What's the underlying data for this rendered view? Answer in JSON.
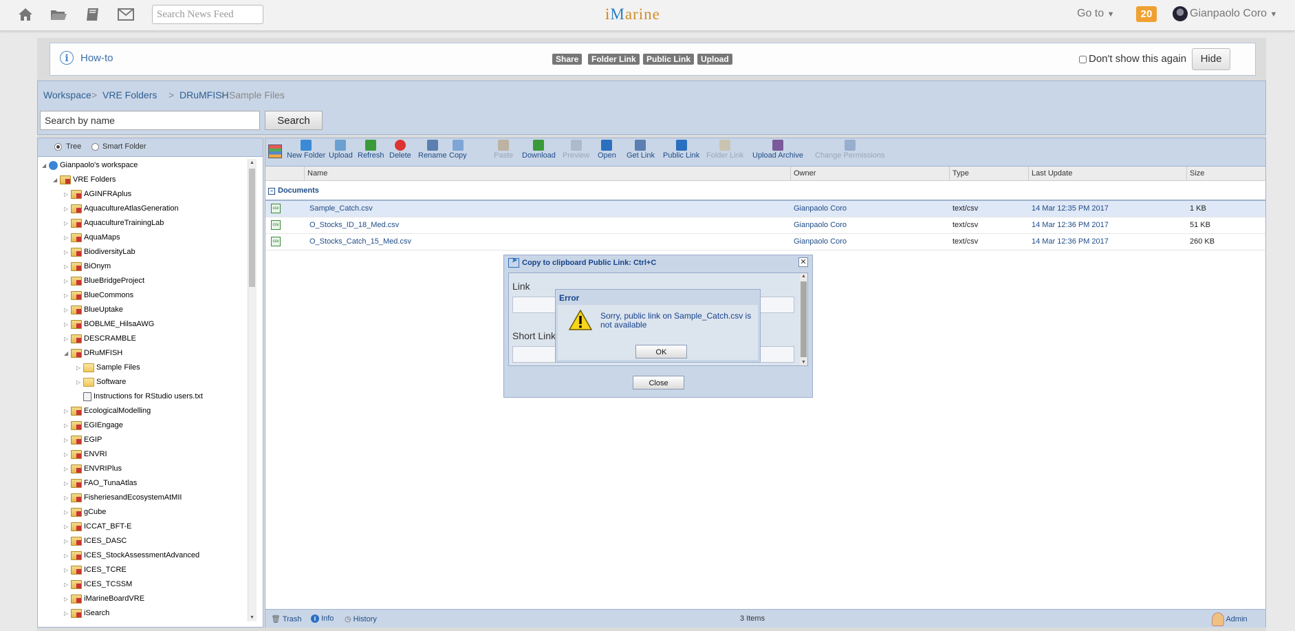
{
  "topnav": {
    "search_placeholder": "Search News Feed",
    "logo_a": "i",
    "logo_b": "M",
    "logo_c": "arine",
    "goto_label": "Go to",
    "notification_count": "20",
    "user_name": "Gianpaolo Coro",
    "icons": [
      "home-icon",
      "folder-icon",
      "book-icon",
      "mail-icon"
    ]
  },
  "howto": {
    "label": "How-to",
    "buttons": [
      "Share",
      "Folder Link",
      "Public Link",
      "Upload"
    ],
    "dont_show": "Don't show this again",
    "hide": "Hide"
  },
  "breadcrumb": {
    "items": [
      "Workspace",
      "VRE Folders",
      "DRuMFISH",
      "Sample Files"
    ],
    "separator": ">"
  },
  "search": {
    "placeholder": "Search by name",
    "button": "Search"
  },
  "tree_options": {
    "tree": "Tree",
    "smart_folder": "Smart Folder"
  },
  "tree": [
    {
      "label": "Gianpaolo's workspace",
      "icon": "user-icon",
      "level": 0,
      "state": "open"
    },
    {
      "label": "VRE Folders",
      "icon": "vre-folder-icon",
      "level": 1,
      "state": "open"
    },
    {
      "label": "AGINFRAplus",
      "icon": "vre-folder-icon",
      "level": 2,
      "state": "closed"
    },
    {
      "label": "AquacultureAtlasGeneration",
      "icon": "vre-folder-icon",
      "level": 2,
      "state": "closed"
    },
    {
      "label": "AquacultureTrainingLab",
      "icon": "vre-folder-icon",
      "level": 2,
      "state": "closed"
    },
    {
      "label": "AquaMaps",
      "icon": "vre-folder-icon",
      "level": 2,
      "state": "closed"
    },
    {
      "label": "BiodiversityLab",
      "icon": "vre-folder-icon",
      "level": 2,
      "state": "closed"
    },
    {
      "label": "BiOnym",
      "icon": "vre-folder-icon",
      "level": 2,
      "state": "closed"
    },
    {
      "label": "BlueBridgeProject",
      "icon": "vre-folder-icon",
      "level": 2,
      "state": "closed"
    },
    {
      "label": "BlueCommons",
      "icon": "vre-folder-icon",
      "level": 2,
      "state": "closed"
    },
    {
      "label": "BlueUptake",
      "icon": "vre-folder-icon",
      "level": 2,
      "state": "closed"
    },
    {
      "label": "BOBLME_HilsaAWG",
      "icon": "vre-folder-icon",
      "level": 2,
      "state": "closed"
    },
    {
      "label": "DESCRAMBLE",
      "icon": "vre-folder-icon",
      "level": 2,
      "state": "closed"
    },
    {
      "label": "DRuMFISH",
      "icon": "vre-folder-icon",
      "level": 2,
      "state": "open"
    },
    {
      "label": "Sample Files",
      "icon": "folder-icon",
      "level": 3,
      "state": "closed"
    },
    {
      "label": "Software",
      "icon": "folder-icon",
      "level": 3,
      "state": "closed"
    },
    {
      "label": "Instructions for RStudio users.txt",
      "icon": "text-file-icon",
      "level": 3,
      "state": "leaf"
    },
    {
      "label": "EcologicalModelling",
      "icon": "vre-folder-icon",
      "level": 2,
      "state": "closed"
    },
    {
      "label": "EGIEngage",
      "icon": "vre-folder-icon",
      "level": 2,
      "state": "closed"
    },
    {
      "label": "EGIP",
      "icon": "vre-folder-icon",
      "level": 2,
      "state": "closed"
    },
    {
      "label": "ENVRI",
      "icon": "vre-folder-icon",
      "level": 2,
      "state": "closed"
    },
    {
      "label": "ENVRIPlus",
      "icon": "vre-folder-icon",
      "level": 2,
      "state": "closed"
    },
    {
      "label": "FAO_TunaAtlas",
      "icon": "vre-folder-icon",
      "level": 2,
      "state": "closed"
    },
    {
      "label": "FisheriesandEcosystemAtMII",
      "icon": "vre-folder-icon",
      "level": 2,
      "state": "closed"
    },
    {
      "label": "gCube",
      "icon": "vre-folder-icon",
      "level": 2,
      "state": "closed"
    },
    {
      "label": "ICCAT_BFT-E",
      "icon": "vre-folder-icon",
      "level": 2,
      "state": "closed"
    },
    {
      "label": "ICES_DASC",
      "icon": "vre-folder-icon",
      "level": 2,
      "state": "closed"
    },
    {
      "label": "ICES_StockAssessmentAdvanced",
      "icon": "vre-folder-icon",
      "level": 2,
      "state": "closed"
    },
    {
      "label": "ICES_TCRE",
      "icon": "vre-folder-icon",
      "level": 2,
      "state": "closed"
    },
    {
      "label": "ICES_TCSSM",
      "icon": "vre-folder-icon",
      "level": 2,
      "state": "closed"
    },
    {
      "label": "iMarineBoardVRE",
      "icon": "vre-folder-icon",
      "level": 2,
      "state": "closed"
    },
    {
      "label": "iSearch",
      "icon": "vre-folder-icon",
      "level": 2,
      "state": "closed"
    }
  ],
  "toolbar": [
    {
      "label": "New Folder",
      "icon": "new-folder-icon",
      "enabled": true
    },
    {
      "label": "Upload",
      "icon": "upload-icon",
      "enabled": true
    },
    {
      "label": "Refresh",
      "icon": "refresh-icon",
      "enabled": true
    },
    {
      "label": "Delete",
      "icon": "delete-icon",
      "enabled": true
    },
    {
      "label": "Rename",
      "icon": "rename-icon",
      "enabled": true
    },
    {
      "label": "Copy",
      "icon": "copy-icon",
      "enabled": true
    },
    {
      "label": "Paste",
      "icon": "paste-icon",
      "enabled": false
    },
    {
      "label": "Download",
      "icon": "download-icon",
      "enabled": true
    },
    {
      "label": "Preview",
      "icon": "preview-icon",
      "enabled": false
    },
    {
      "label": "Open",
      "icon": "open-icon",
      "enabled": true
    },
    {
      "label": "Get Link",
      "icon": "get-link-icon",
      "enabled": true
    },
    {
      "label": "Public Link",
      "icon": "public-link-icon",
      "enabled": true
    },
    {
      "label": "Folder Link",
      "icon": "folder-link-icon",
      "enabled": false
    },
    {
      "label": "Upload Archive",
      "icon": "upload-archive-icon",
      "enabled": true
    },
    {
      "label": "Change Permissions",
      "icon": "change-permissions-icon",
      "enabled": false
    }
  ],
  "grid": {
    "columns": [
      "Name",
      "Owner",
      "Type",
      "Last Update",
      "Size"
    ],
    "group": "Documents",
    "rows": [
      {
        "name": "Sample_Catch.csv",
        "owner": "Gianpaolo Coro",
        "type": "text/csv",
        "updated": "14 Mar 12:35 PM 2017",
        "size": "1 KB",
        "selected": true
      },
      {
        "name": "O_Stocks_ID_18_Med.csv",
        "owner": "Gianpaolo Coro",
        "type": "text/csv",
        "updated": "14 Mar 12:36 PM 2017",
        "size": "51 KB",
        "selected": false
      },
      {
        "name": "O_Stocks_Catch_15_Med.csv",
        "owner": "Gianpaolo Coro",
        "type": "text/csv",
        "updated": "14 Mar 12:36 PM 2017",
        "size": "260 KB",
        "selected": false
      }
    ]
  },
  "status": {
    "trash": "Trash",
    "info": "Info",
    "history": "History",
    "count": "3 Items",
    "admin": "Admin"
  },
  "copy_dialog": {
    "title": "Copy to clipboard Public Link: Ctrl+C",
    "link_label": "Link",
    "short_link_label": "Short Link",
    "close": "Close"
  },
  "error_dialog": {
    "title": "Error",
    "message": "Sorry, public link on Sample_Catch.csv is not available",
    "ok": "OK"
  },
  "colors": {
    "accent_blue": "#1f4c87",
    "panel_blue": "#c9d6e7",
    "notification": "#f0a030"
  }
}
